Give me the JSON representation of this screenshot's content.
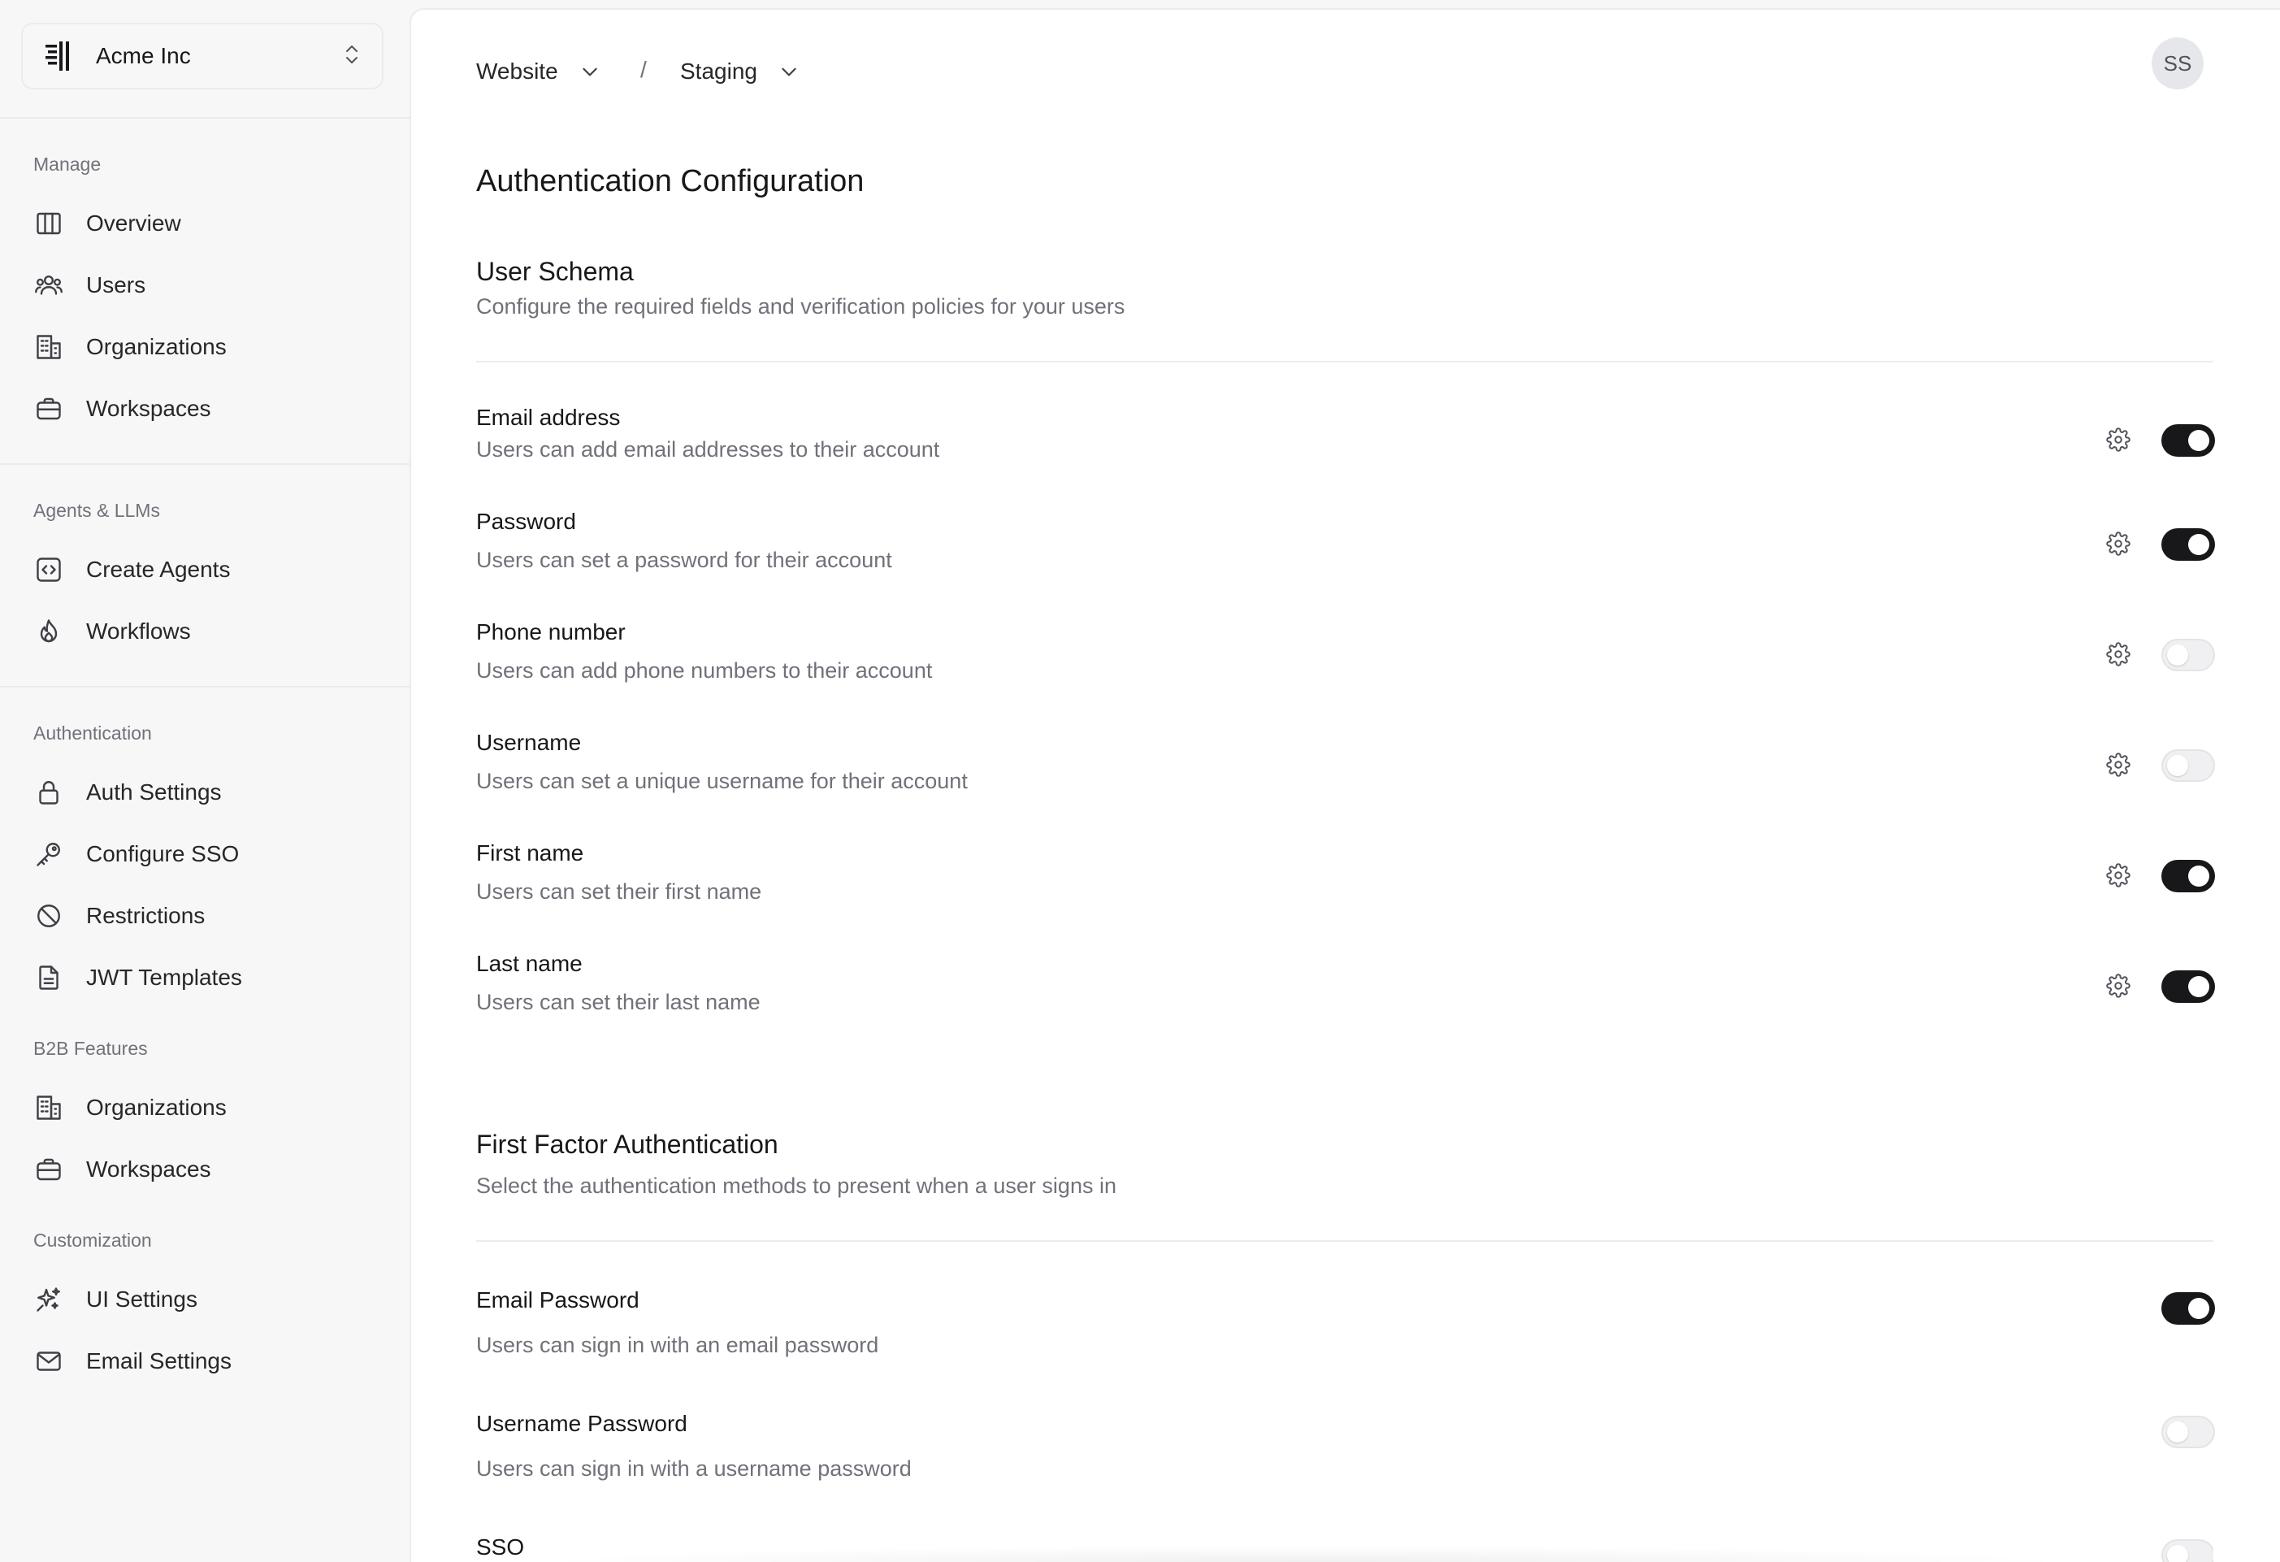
{
  "org": {
    "name": "Acme Inc"
  },
  "sidebar": {
    "sections": [
      {
        "heading": "Manage",
        "items": [
          {
            "label": "Overview",
            "icon": "columns-icon"
          },
          {
            "label": "Users",
            "icon": "users-icon"
          },
          {
            "label": "Organizations",
            "icon": "building-icon"
          },
          {
            "label": "Workspaces",
            "icon": "briefcase-icon"
          }
        ]
      },
      {
        "heading": "Agents & LLMs",
        "items": [
          {
            "label": "Create Agents",
            "icon": "code-square-icon"
          },
          {
            "label": "Workflows",
            "icon": "flame-icon"
          }
        ]
      },
      {
        "heading": "Authentication",
        "items": [
          {
            "label": "Auth Settings",
            "icon": "lock-icon"
          },
          {
            "label": "Configure SSO",
            "icon": "key-icon"
          },
          {
            "label": "Restrictions",
            "icon": "ban-icon"
          },
          {
            "label": "JWT Templates",
            "icon": "file-icon"
          }
        ]
      },
      {
        "heading": "B2B Features",
        "items": [
          {
            "label": "Organizations",
            "icon": "building-icon"
          },
          {
            "label": "Workspaces",
            "icon": "briefcase-icon"
          }
        ]
      },
      {
        "heading": "Customization",
        "items": [
          {
            "label": "UI Settings",
            "icon": "sparkles-icon"
          },
          {
            "label": "Email Settings",
            "icon": "mail-icon"
          }
        ]
      }
    ]
  },
  "header": {
    "breadcrumb": [
      {
        "label": "Website"
      },
      {
        "label": "Staging"
      }
    ],
    "separator": "/",
    "avatar_initials": "SS"
  },
  "main": {
    "page_title": "Authentication Configuration",
    "user_schema": {
      "title": "User Schema",
      "description": "Configure the required fields and verification policies for your users",
      "fields": [
        {
          "title": "Email address",
          "description": "Users can add email addresses to their account",
          "enabled": true
        },
        {
          "title": "Password",
          "description": "Users can set a password for their account",
          "enabled": true
        },
        {
          "title": "Phone number",
          "description": "Users can add phone numbers to their account",
          "enabled": false
        },
        {
          "title": "Username",
          "description": "Users can set a unique username for their account",
          "enabled": false
        },
        {
          "title": "First name",
          "description": "Users can set their first name",
          "enabled": true
        },
        {
          "title": "Last name",
          "description": "Users can set their last name",
          "enabled": true
        }
      ]
    },
    "first_factor": {
      "title": "First Factor Authentication",
      "description": "Select the authentication methods to present when a user signs in",
      "methods": [
        {
          "title": "Email Password",
          "description": "Users can sign in with an email password",
          "enabled": true
        },
        {
          "title": "Username Password",
          "description": "Users can sign in with a username password",
          "enabled": false
        },
        {
          "title": "SSO",
          "description": "",
          "enabled": false
        }
      ]
    }
  },
  "colors": {
    "toggle_on": "#18181b",
    "toggle_off": "#f0f0f2",
    "muted_text": "#71717a"
  }
}
